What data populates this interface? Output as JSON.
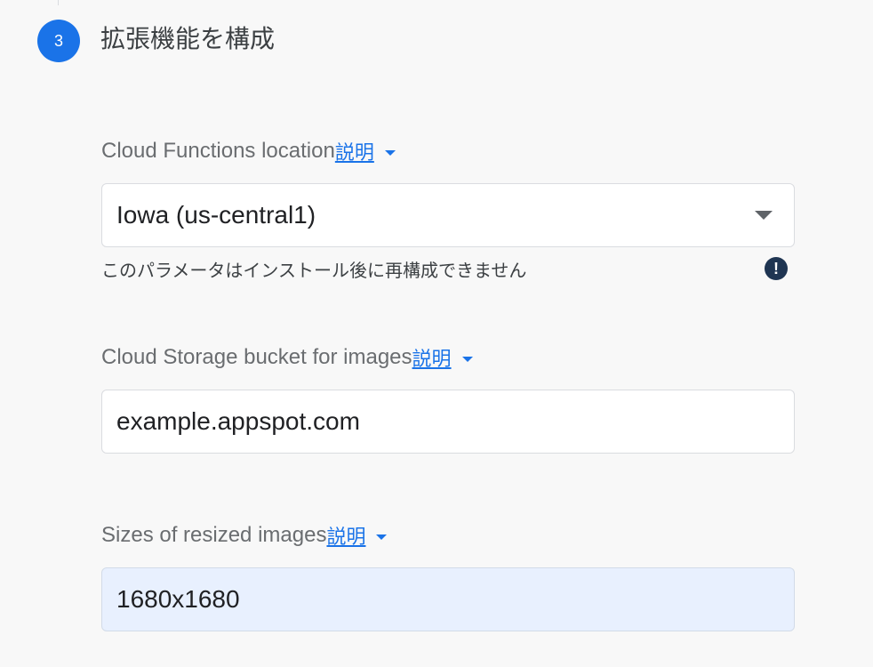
{
  "step": {
    "number": "3",
    "title": "拡張機能を構成"
  },
  "fields": [
    {
      "label": "Cloud Functions location",
      "learn_more": "説明",
      "value": "Iowa (us-central1)",
      "helper_text": "このパラメータはインストール後に再構成できません"
    },
    {
      "label": "Cloud Storage bucket for images",
      "learn_more": "説明",
      "value": "example.appspot.com"
    },
    {
      "label": "Sizes of resized images",
      "learn_more": "説明",
      "value": "1680x1680"
    }
  ],
  "icons": {
    "step_badge": "step-number-circle",
    "caret": "caret-down-icon",
    "select_arrow": "dropdown-arrow-icon",
    "warning": "exclamation-icon"
  },
  "colors": {
    "accent": "#1a73e8",
    "warning_icon": "#1f3552",
    "highlight_field": "#e8f0fe"
  }
}
